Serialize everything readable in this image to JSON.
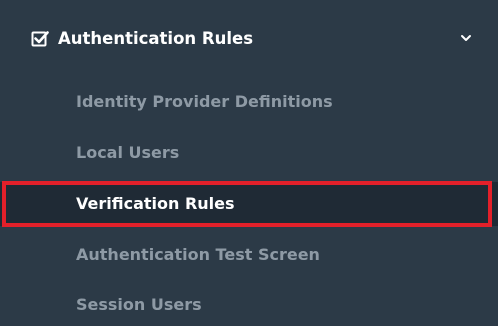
{
  "section": {
    "title": "Authentication Rules",
    "icon": "checkbox-icon",
    "expanded_icon": "chevron-down-icon"
  },
  "menu": {
    "items": [
      {
        "label": "Identity Provider Definitions",
        "active": false
      },
      {
        "label": "Local Users",
        "active": false
      },
      {
        "label": "Verification Rules",
        "active": true
      },
      {
        "label": "Authentication Test Screen",
        "active": false
      },
      {
        "label": "Session Users",
        "active": false
      }
    ]
  },
  "colors": {
    "background": "#2c3a47",
    "active_background": "#1f2a35",
    "highlight": "#e3202a",
    "inactive_text": "#8e9aa5",
    "active_text": "#ffffff"
  }
}
